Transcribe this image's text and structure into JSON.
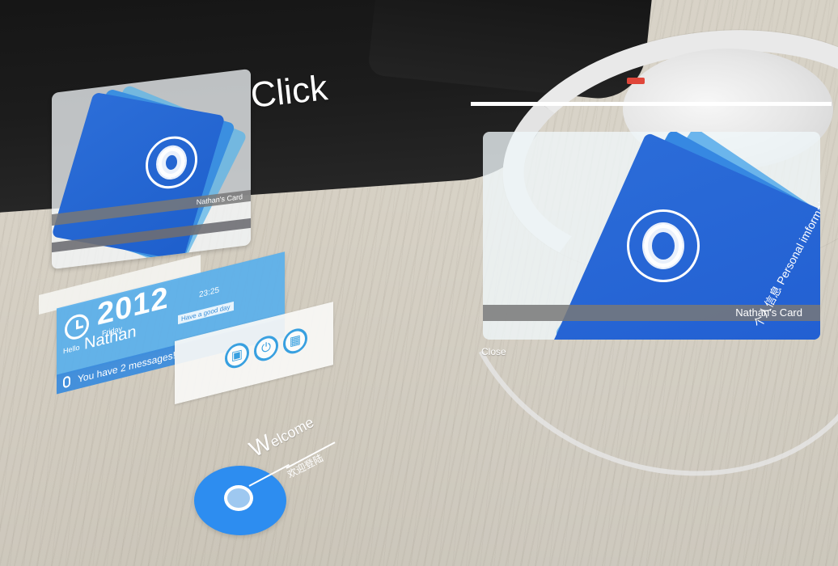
{
  "click_label": "Click",
  "card": {
    "owner_label": "Nathan's Card",
    "subtitle": "个人信息 Personal imformaiton"
  },
  "status": {
    "year": "2012",
    "time": "23:25",
    "weekday": "Friday",
    "hello": "Hello",
    "name": "Nathan",
    "good_day": "Have a good day",
    "message": "You have 2 messages!"
  },
  "welcome": {
    "first_letter": "W",
    "rest": "elcome",
    "subtitle": "欢迎登陆"
  },
  "detail": {
    "close_label": "Close"
  },
  "colors": {
    "accent_blue": "#2d8df0",
    "card_blue": "#1f5bd0",
    "panel_blue": "#5aafeb"
  },
  "icons": {
    "card": "fingerprint-icon",
    "status": "clock-icon",
    "message": "microphone-icon",
    "actions": [
      "box-icon",
      "power-icon",
      "grid-icon"
    ]
  }
}
